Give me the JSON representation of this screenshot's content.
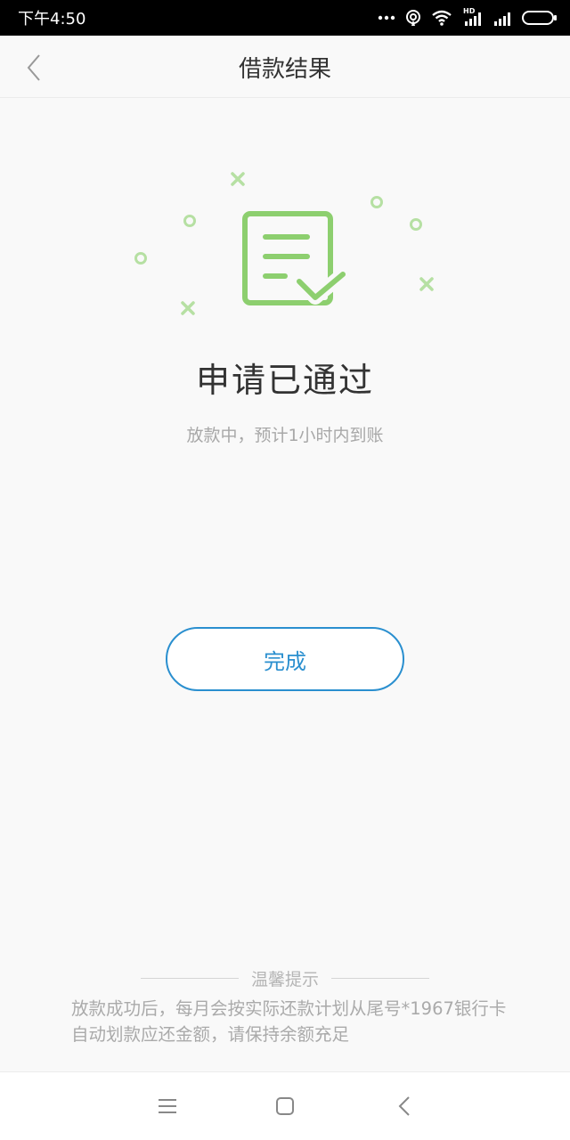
{
  "status_bar": {
    "time": "下午4:50",
    "icons": [
      "more-dots-icon",
      "hotspot-icon",
      "wifi-hd-icon",
      "signal-icon",
      "signal-icon",
      "battery-icon"
    ],
    "hd_label": "HD"
  },
  "header": {
    "title": "借款结果",
    "back_icon": "chevron-left-icon"
  },
  "result": {
    "illustration_icon": "document-check-icon",
    "accent_color": "#8dcf6f",
    "title": "申请已通过",
    "subtitle": "放款中，预计1小时内到账"
  },
  "actions": {
    "done_label": "完成",
    "done_color": "#2a8fcf"
  },
  "tips": {
    "title": "温馨提示",
    "text": "放款成功后，每月会按实际还款计划从尾号*1967银行卡自动划款应还金额，请保持余额充足"
  },
  "nav_bar": {
    "icons": [
      "menu-icon",
      "home-square-icon",
      "back-chevron-icon"
    ]
  }
}
